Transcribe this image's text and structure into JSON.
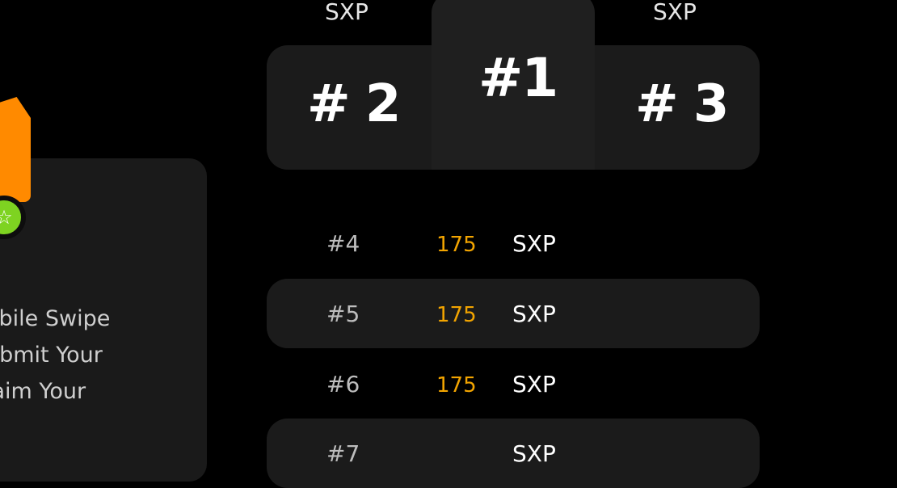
{
  "left": {
    "lines": [
      "obile Swipe",
      "ubmit Your",
      "laim Your"
    ],
    "star_icon": "star-icon"
  },
  "podium": {
    "second_unit": "SXP",
    "third_unit": "SXP",
    "first_label": "#1",
    "second_label": "# 2",
    "third_label": "# 3"
  },
  "list": [
    {
      "rank": "#4",
      "value": "175",
      "unit": "SXP"
    },
    {
      "rank": "#5",
      "value": "175",
      "unit": "SXP"
    },
    {
      "rank": "#6",
      "value": "175",
      "unit": "SXP"
    },
    {
      "rank": "#7",
      "value": "",
      "unit": "SXP"
    }
  ],
  "colors": {
    "accent_value": "#f2a400",
    "orange": "#ff8a00",
    "green": "#7ed321"
  }
}
